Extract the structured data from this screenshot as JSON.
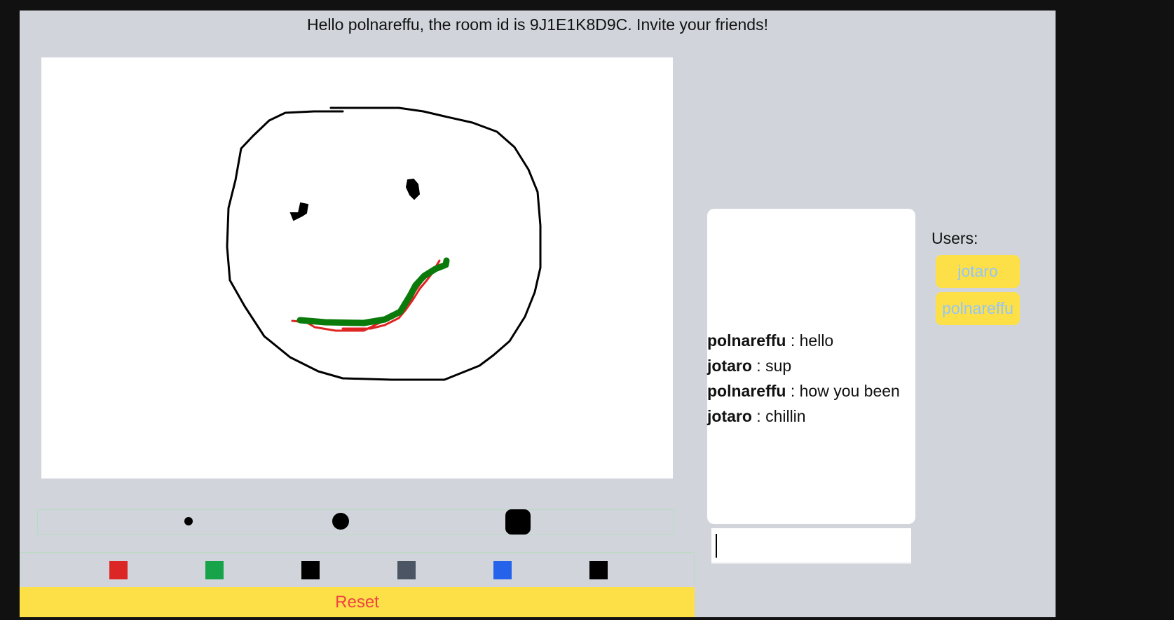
{
  "header": {
    "greeting": "Hello polnareffu, the room id is 9J1E1K8D9C. Invite your friends!"
  },
  "canvas": {
    "background": "#ffffff",
    "strokes": [
      {
        "name": "face-outline",
        "color": "#000000"
      },
      {
        "name": "left-eye",
        "color": "#000000"
      },
      {
        "name": "right-eye",
        "color": "#000000"
      },
      {
        "name": "smile-red",
        "color": "#e02424"
      },
      {
        "name": "smile-green",
        "color": "#0a7a0a"
      }
    ]
  },
  "brushes": [
    {
      "name": "small",
      "shape": "dot"
    },
    {
      "name": "medium",
      "shape": "circle"
    },
    {
      "name": "large",
      "shape": "rounded-square"
    }
  ],
  "colors": [
    "#dc2626",
    "#16a34a",
    "#000000",
    "#4b5563",
    "#2563eb",
    "#000000"
  ],
  "toolbar": {
    "reset_label": "Reset"
  },
  "chat": {
    "messages": [
      {
        "user": "polnareffu",
        "sep": " : ",
        "text": "hello"
      },
      {
        "user": "jotaro",
        "sep": " : ",
        "text": "sup"
      },
      {
        "user": "polnareffu",
        "sep": " : ",
        "text": "how you been"
      },
      {
        "user": "jotaro",
        "sep": " : ",
        "text": "chillin"
      }
    ],
    "input_value": ""
  },
  "users": {
    "label": "Users:",
    "list": [
      "jotaro",
      "polnareffu"
    ]
  },
  "theme": {
    "panel_bg": "#d1d5db",
    "accent_yellow": "#fde047",
    "reset_text": "#ef4444",
    "user_text": "#93c5fd"
  }
}
